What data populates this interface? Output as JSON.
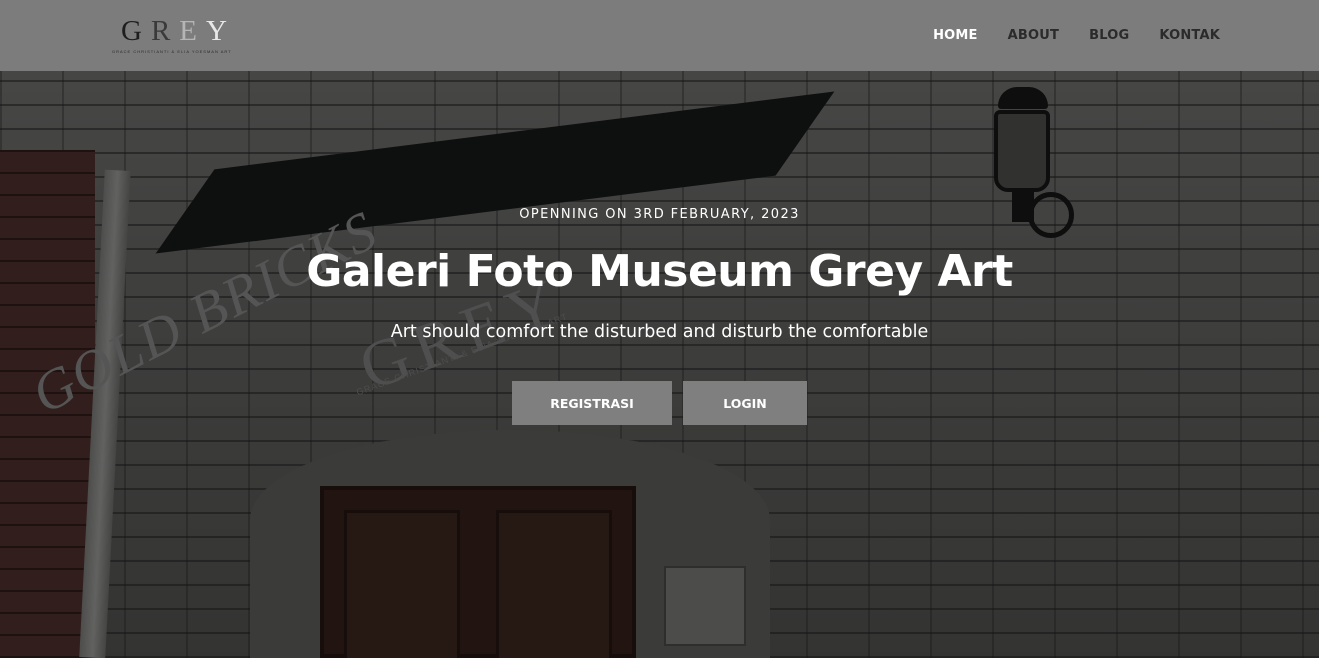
{
  "header": {
    "logo_text": "GREY",
    "logo_sub": "GRACE CHRISTIANTI & ELIA YOESMAN ART",
    "nav": [
      {
        "label": "HOME",
        "active": true
      },
      {
        "label": "ABOUT",
        "active": false
      },
      {
        "label": "BLOG",
        "active": false
      },
      {
        "label": "KONTAK",
        "active": false
      }
    ]
  },
  "hero": {
    "eyebrow": "OPENNING ON 3RD FEBRUARY, 2023",
    "title": "Galeri Foto Museum Grey Art",
    "tagline": "Art should comfort the disturbed and disturb the comfortable",
    "buttons": {
      "register": "REGISTRASI",
      "login": "LOGIN"
    },
    "background": {
      "awning_text": "GOLD BRICKS",
      "awning_logo": "GREY",
      "awning_sub": "GRACE CHRISTIANTI & ELIA YOESMAN ART"
    }
  },
  "colors": {
    "header_bg": "#7c7c7c",
    "button_bg": "#7f7f7f",
    "text_light": "#ffffff",
    "nav_text": "#2b2b2b"
  }
}
